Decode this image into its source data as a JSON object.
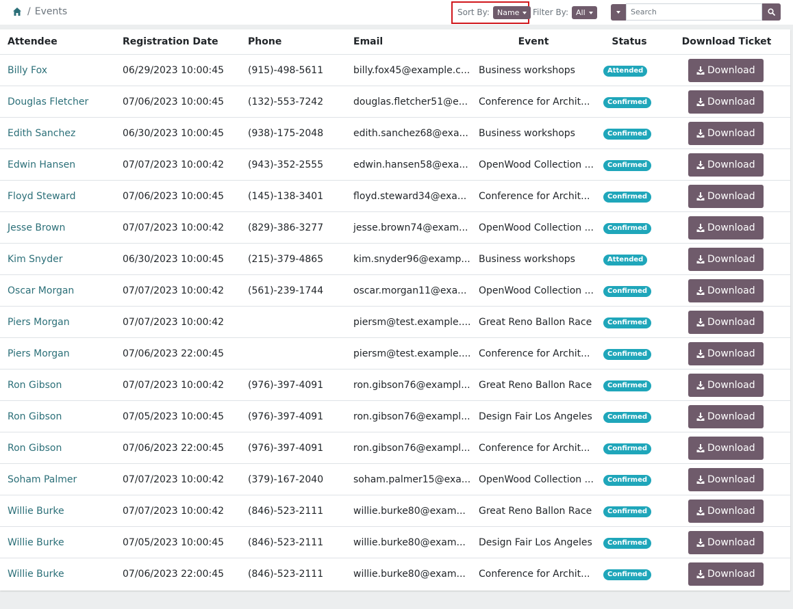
{
  "breadcrumb": {
    "home_icon": "home-icon",
    "separator": "/",
    "current": "Events"
  },
  "toolbar": {
    "sort_label": "Sort By:",
    "sort_value": "Name",
    "filter_label": "Filter By:",
    "filter_value": "All",
    "search_placeholder": "Search",
    "search_value": "",
    "accent_color": "#6f5b6b",
    "highlight_color": "#d0161b"
  },
  "table": {
    "headers": [
      "Attendee",
      "Registration Date",
      "Phone",
      "Email",
      "Event",
      "Status",
      "Download Ticket"
    ],
    "rows": [
      {
        "attendee": "Billy Fox",
        "date": "06/29/2023 10:00:45",
        "phone": "(915)-498-5611",
        "email": "billy.fox45@example.c...",
        "event": "Business workshops",
        "status": "Attended",
        "download": "Download"
      },
      {
        "attendee": "Douglas Fletcher",
        "date": "07/06/2023 10:00:45",
        "phone": "(132)-553-7242",
        "email": "douglas.fletcher51@e...",
        "event": "Conference for Archit...",
        "status": "Confirmed",
        "download": "Download"
      },
      {
        "attendee": "Edith Sanchez",
        "date": "06/30/2023 10:00:45",
        "phone": "(938)-175-2048",
        "email": "edith.sanchez68@exa...",
        "event": "Business workshops",
        "status": "Confirmed",
        "download": "Download"
      },
      {
        "attendee": "Edwin Hansen",
        "date": "07/07/2023 10:00:42",
        "phone": "(943)-352-2555",
        "email": "edwin.hansen58@exa...",
        "event": "OpenWood Collection ...",
        "status": "Confirmed",
        "download": "Download"
      },
      {
        "attendee": "Floyd Steward",
        "date": "07/06/2023 10:00:45",
        "phone": "(145)-138-3401",
        "email": "floyd.steward34@exa...",
        "event": "Conference for Archit...",
        "status": "Confirmed",
        "download": "Download"
      },
      {
        "attendee": "Jesse Brown",
        "date": "07/07/2023 10:00:42",
        "phone": "(829)-386-3277",
        "email": "jesse.brown74@exam...",
        "event": "OpenWood Collection ...",
        "status": "Confirmed",
        "download": "Download"
      },
      {
        "attendee": "Kim Snyder",
        "date": "06/30/2023 10:00:45",
        "phone": "(215)-379-4865",
        "email": "kim.snyder96@examp...",
        "event": "Business workshops",
        "status": "Attended",
        "download": "Download"
      },
      {
        "attendee": "Oscar Morgan",
        "date": "07/07/2023 10:00:42",
        "phone": "(561)-239-1744",
        "email": "oscar.morgan11@exa...",
        "event": "OpenWood Collection ...",
        "status": "Confirmed",
        "download": "Download"
      },
      {
        "attendee": "Piers Morgan",
        "date": "07/07/2023 10:00:42",
        "phone": "",
        "email": "piersm@test.example....",
        "event": "Great Reno Ballon Race",
        "status": "Confirmed",
        "download": "Download"
      },
      {
        "attendee": "Piers Morgan",
        "date": "07/06/2023 22:00:45",
        "phone": "",
        "email": "piersm@test.example....",
        "event": "Conference for Archit...",
        "status": "Confirmed",
        "download": "Download"
      },
      {
        "attendee": "Ron Gibson",
        "date": "07/07/2023 10:00:42",
        "phone": "(976)-397-4091",
        "email": "ron.gibson76@exampl...",
        "event": "Great Reno Ballon Race",
        "status": "Confirmed",
        "download": "Download"
      },
      {
        "attendee": "Ron Gibson",
        "date": "07/05/2023 10:00:45",
        "phone": "(976)-397-4091",
        "email": "ron.gibson76@exampl...",
        "event": "Design Fair Los Angeles",
        "status": "Confirmed",
        "download": "Download"
      },
      {
        "attendee": "Ron Gibson",
        "date": "07/06/2023 22:00:45",
        "phone": "(976)-397-4091",
        "email": "ron.gibson76@exampl...",
        "event": "Conference for Archit...",
        "status": "Confirmed",
        "download": "Download"
      },
      {
        "attendee": "Soham Palmer",
        "date": "07/07/2023 10:00:42",
        "phone": "(379)-167-2040",
        "email": "soham.palmer15@exa...",
        "event": "OpenWood Collection ...",
        "status": "Confirmed",
        "download": "Download"
      },
      {
        "attendee": "Willie Burke",
        "date": "07/07/2023 10:00:42",
        "phone": "(846)-523-2111",
        "email": "willie.burke80@exam...",
        "event": "Great Reno Ballon Race",
        "status": "Confirmed",
        "download": "Download"
      },
      {
        "attendee": "Willie Burke",
        "date": "07/05/2023 10:00:45",
        "phone": "(846)-523-2111",
        "email": "willie.burke80@exam...",
        "event": "Design Fair Los Angeles",
        "status": "Confirmed",
        "download": "Download"
      },
      {
        "attendee": "Willie Burke",
        "date": "07/06/2023 22:00:45",
        "phone": "(846)-523-2111",
        "email": "willie.burke80@exam...",
        "event": "Conference for Archit...",
        "status": "Confirmed",
        "download": "Download"
      }
    ]
  },
  "status_color": "#1fa6ba",
  "link_color": "#2b6f78"
}
